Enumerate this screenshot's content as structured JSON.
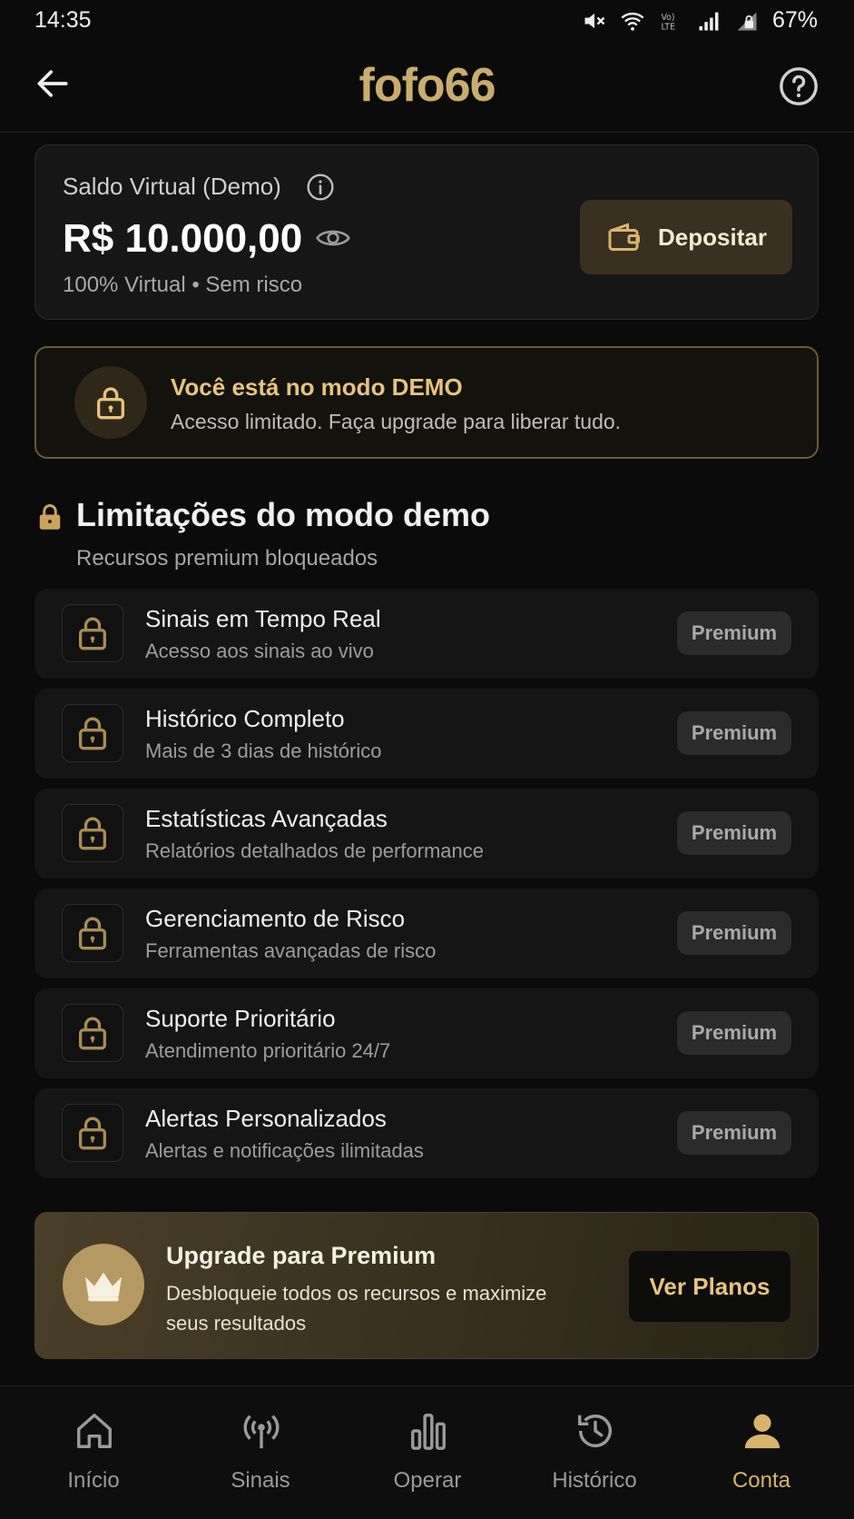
{
  "status_bar": {
    "time": "14:35",
    "battery": "67%"
  },
  "header": {
    "title": "fofo66"
  },
  "balance": {
    "label": "Saldo Virtual (Demo)",
    "value": "R$ 10.000,00",
    "subtitle": "100% Virtual • Sem risco",
    "deposit_label": "Depositar"
  },
  "demo_banner": {
    "title": "Você está no modo DEMO",
    "subtitle": "Acesso limitado. Faça upgrade para liberar tudo."
  },
  "limitations": {
    "title": "Limitações do modo demo",
    "subtitle": "Recursos premium bloqueados",
    "items": [
      {
        "title": "Sinais em Tempo Real",
        "desc": "Acesso aos sinais ao vivo",
        "badge": "Premium"
      },
      {
        "title": "Histórico Completo",
        "desc": "Mais de 3 dias de histórico",
        "badge": "Premium"
      },
      {
        "title": "Estatísticas Avançadas",
        "desc": "Relatórios detalhados de performance",
        "badge": "Premium"
      },
      {
        "title": "Gerenciamento de Risco",
        "desc": "Ferramentas avançadas de risco",
        "badge": "Premium"
      },
      {
        "title": "Suporte Prioritário",
        "desc": "Atendimento prioritário 24/7",
        "badge": "Premium"
      },
      {
        "title": "Alertas Personalizados",
        "desc": "Alertas e notificações ilimitadas",
        "badge": "Premium"
      }
    ]
  },
  "upgrade": {
    "title": "Upgrade para Premium",
    "desc": "Desbloqueie todos os recursos e maximize seus resultados",
    "button": "Ver Planos"
  },
  "bottom_nav": {
    "items": [
      {
        "label": "Início",
        "icon": "home-icon"
      },
      {
        "label": "Sinais",
        "icon": "broadcast-icon"
      },
      {
        "label": "Operar",
        "icon": "bar-chart-icon"
      },
      {
        "label": "Histórico",
        "icon": "history-icon"
      },
      {
        "label": "Conta",
        "icon": "user-icon"
      }
    ],
    "active_index": 4
  },
  "colors": {
    "accent_gold": "#d6b46a",
    "background": "#0b0b0b",
    "card": "#161616"
  }
}
